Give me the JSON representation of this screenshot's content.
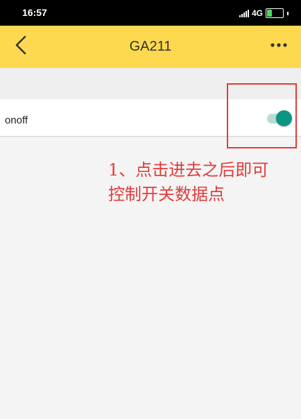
{
  "status_bar": {
    "time": "16:57",
    "network": "4G",
    "battery_text": "33",
    "battery_level": 0.33
  },
  "header": {
    "title": "GA211",
    "back_icon": "chevron-left-icon",
    "more_icon": "more-horizontal-icon",
    "background_color": "#fdd94f"
  },
  "rows": [
    {
      "label": "onoff",
      "toggle_on": true
    }
  ],
  "annotation": {
    "line1": "1、点击进去之后即可",
    "line2": "控制开关数据点",
    "color": "#e33a3a"
  },
  "colors": {
    "toggle_accent": "#0c9584"
  }
}
